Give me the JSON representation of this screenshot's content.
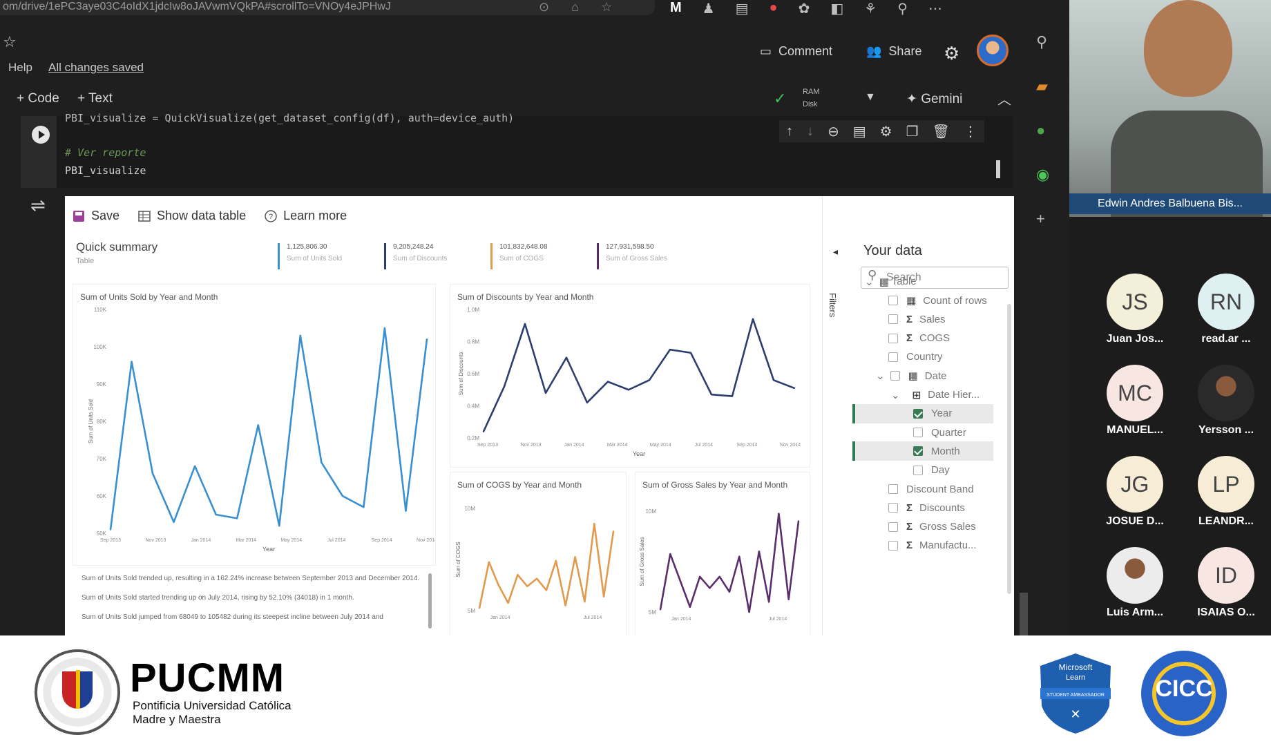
{
  "browser": {
    "url": "om/drive/1ePC3aye03C4oIdX1jdcIw8oJAVwmVQkPA#scrollTo=VNOy4eJPHwJ",
    "browser_icons": [
      "bookmark-icon",
      "cast-icon",
      "star-icon"
    ],
    "extension_icons": [
      "gmail-icon",
      "profile-icon",
      "docs-icon",
      "record-icon",
      "puzzle-icon",
      "sidebar-icon",
      "translate-icon",
      "user-icon",
      "more-icon"
    ]
  },
  "colab": {
    "help": "Help",
    "saved": "All changes saved",
    "comment": "Comment",
    "share": "Share",
    "code_button": "+ Code",
    "text_button": "+ Text",
    "ram": "RAM",
    "disk": "Disk",
    "gemini": "Gemini",
    "code_lines": [
      "PBI_visualize = QuickVisualize(get_dataset_config(df), auth=device_auth)",
      "# Ver reporte",
      "PBI_visualize"
    ]
  },
  "report": {
    "toolbar": {
      "save": "Save",
      "show_table": "Show data table",
      "learn_more": "Learn more"
    },
    "summary_title": "Quick summary",
    "summary_sub": "Table",
    "kpis": [
      {
        "value": "1,125,806.30",
        "label": "Sum of Units Sold",
        "color": "#3a8fd0"
      },
      {
        "value": "9,205,248.24",
        "label": "Sum of Discounts",
        "color": "#2c3e6e"
      },
      {
        "value": "101,832,648.08",
        "label": "Sum of COGS",
        "color": "#e29a4c"
      },
      {
        "value": "127,931,598.50",
        "label": "Sum of Gross Sales",
        "color": "#5a2d6b"
      }
    ],
    "narrative": [
      "Sum of Units Sold trended up, resulting in a 162.24% increase between September 2013 and December 2014.",
      "Sum of Units Sold started trending up on July 2014, rising by 52.10% (34018) in 1 month.",
      "Sum of Units Sold jumped from 68049 to 105482 during its steepest incline between July 2014 and"
    ],
    "filters_label": "Filters"
  },
  "chart_data": [
    {
      "type": "line",
      "title": "Sum of Units Sold by Year and Month",
      "xlabel": "Year",
      "ylabel": "Sum of Units Sold",
      "color": "#3a8fd0",
      "x_ticks": [
        "Sep 2013",
        "Nov 2013",
        "Jan 2014",
        "Mar 2014",
        "May 2014",
        "Jul 2014",
        "Sep 2014",
        "Nov 2014"
      ],
      "y_ticks": [
        "50K",
        "60K",
        "70K",
        "80K",
        "90K",
        "100K",
        "110K"
      ],
      "ylim": [
        50000,
        110000
      ],
      "values": [
        51000,
        96000,
        66000,
        53000,
        68000,
        55000,
        54000,
        79000,
        52000,
        103000,
        69000,
        60000,
        57000,
        105000,
        56000,
        102000
      ]
    },
    {
      "type": "line",
      "title": "Sum of Discounts by Year and Month",
      "xlabel": "Year",
      "ylabel": "Sum of Discounts",
      "color": "#2c3e6e",
      "x_ticks": [
        "Sep 2013",
        "Nov 2013",
        "Jan 2014",
        "Mar 2014",
        "May 2014",
        "Jul 2014",
        "Sep 2014",
        "Nov 2014"
      ],
      "y_ticks": [
        "0.2M",
        "0.4M",
        "0.6M",
        "0.8M",
        "1.0M"
      ],
      "ylim": [
        0.2,
        1.0
      ],
      "values": [
        0.24,
        0.52,
        0.91,
        0.48,
        0.7,
        0.42,
        0.55,
        0.5,
        0.56,
        0.75,
        0.73,
        0.47,
        0.46,
        0.94,
        0.56,
        0.51
      ]
    },
    {
      "type": "line",
      "title": "Sum of COGS by Year and Month",
      "xlabel": "",
      "ylabel": "Sum of COGS",
      "color": "#e29a4c",
      "x_ticks": [
        "Jan 2014",
        "Jul 2014"
      ],
      "y_ticks": [
        "5M",
        "10M"
      ],
      "ylim": [
        3,
        11
      ],
      "values": [
        3.2,
        6.8,
        5.0,
        3.6,
        5.8,
        4.9,
        5.5,
        4.6,
        6.9,
        3.4,
        7.2,
        3.7,
        9.8,
        4.1,
        9.2
      ]
    },
    {
      "type": "line",
      "title": "Sum of Gross Sales by Year and Month",
      "xlabel": "",
      "ylabel": "Sum of Gross Sales",
      "color": "#5a2d6b",
      "x_ticks": [
        "Jan 2014",
        "Jul 2014"
      ],
      "y_ticks": [
        "5M",
        "10M"
      ],
      "ylim": [
        4,
        12
      ],
      "values": [
        4.2,
        8.6,
        6.5,
        4.4,
        6.8,
        5.9,
        6.8,
        5.6,
        8.4,
        4.0,
        8.8,
        4.8,
        11.8,
        5.0,
        11.2
      ]
    }
  ],
  "data_pane": {
    "title": "Your data",
    "search_placeholder": "Search",
    "table": "Table",
    "fields": [
      {
        "label": "Count of rows",
        "kind": "calc",
        "checked": false
      },
      {
        "label": "Sales",
        "kind": "sum",
        "checked": false
      },
      {
        "label": "COGS",
        "kind": "sum",
        "checked": false
      },
      {
        "label": "Country",
        "kind": "text",
        "checked": false
      },
      {
        "label": "Date",
        "kind": "table",
        "checked": false
      },
      {
        "label": "Date Hier...",
        "kind": "hier",
        "checked": false
      },
      {
        "label": "Year",
        "kind": "level",
        "checked": true
      },
      {
        "label": "Quarter",
        "kind": "level",
        "checked": false
      },
      {
        "label": "Month",
        "kind": "level",
        "checked": true
      },
      {
        "label": "Day",
        "kind": "level",
        "checked": false
      },
      {
        "label": "Discount Band",
        "kind": "text",
        "checked": false
      },
      {
        "label": "Discounts",
        "kind": "sum",
        "checked": false
      },
      {
        "label": "Gross Sales",
        "kind": "sum",
        "checked": false
      },
      {
        "label": "Manufactu...",
        "kind": "sum",
        "checked": false
      }
    ]
  },
  "meeting": {
    "speaker": "Edwin Andres Balbuena Bis...",
    "participants": [
      {
        "initials": "JS",
        "name": "Juan Jos...",
        "color": "#f4efd9"
      },
      {
        "initials": "RN",
        "name": "read.ar ...",
        "color": "#dff0f3"
      },
      {
        "initials": "MC",
        "name": "MANUEL...",
        "color": "#f7e6e2"
      },
      {
        "initials": "",
        "name": "Yersson ...",
        "color": "#2a2a2a"
      },
      {
        "initials": "JG",
        "name": "JOSUE D...",
        "color": "#f7ecd5"
      },
      {
        "initials": "LP",
        "name": "LEANDR...",
        "color": "#f7ecd5"
      },
      {
        "initials": "",
        "name": "Luis Arm...",
        "color": "#ececec"
      },
      {
        "initials": "ID",
        "name": "ISAIAS O...",
        "color": "#f7e6e2"
      }
    ]
  },
  "footer": {
    "university": "PUCMM",
    "line1": "Pontificia Universidad Católica",
    "line2": "Madre y Maestra",
    "mlsa_line1": "Microsoft",
    "mlsa_line2": "Learn",
    "mlsa_line3": "STUDENT AMBASSADOR",
    "cicc": "CICC"
  }
}
